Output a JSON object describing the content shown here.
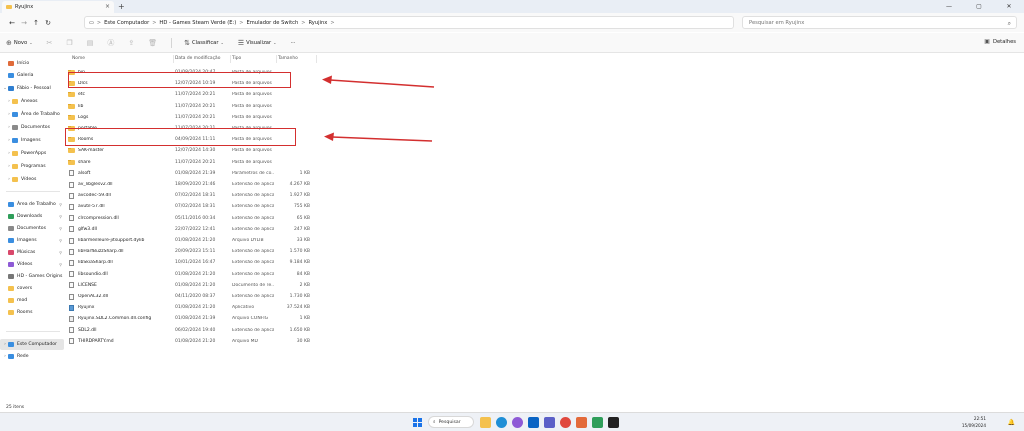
{
  "window": {
    "tab_title": "Ryujinx",
    "tab_close": "×",
    "tab_add": "+",
    "controls": {
      "minimize": "—",
      "maximize": "▢",
      "close": "✕"
    }
  },
  "address": {
    "crumbs": [
      "Este Computador",
      "HD - Games Steam Verde (E:)",
      "Emulador de Switch",
      "Ryujinx"
    ],
    "separator": ">",
    "search_placeholder": "Pesquisar em Ryujinx"
  },
  "toolbar": {
    "new_label": "Novo",
    "sort_label": "Classificar",
    "view_label": "Visualizar",
    "more_label": "···",
    "details_label": "Detalhes"
  },
  "sidebar": {
    "items": [
      {
        "label": "Início",
        "color": "#e06b3a"
      },
      {
        "label": "Galeria",
        "color": "#3a8ee0"
      },
      {
        "label": "Fábio - Pessoal",
        "color": "#2f7fd1"
      },
      {
        "label": "Anexos",
        "color": "#f4c14e"
      },
      {
        "label": "Área de Trabalho",
        "color": "#3a8ee0"
      },
      {
        "label": "Documentos",
        "color": "#8a8a8a"
      },
      {
        "label": "Imagens",
        "color": "#3a8ee0"
      },
      {
        "label": "PowerApps",
        "color": "#f4c14e"
      },
      {
        "label": "Programas",
        "color": "#f4c14e"
      },
      {
        "label": "Vídeos",
        "color": "#f4c14e"
      },
      {
        "label": "Área de Trabalho",
        "color": "#3a8ee0"
      },
      {
        "label": "Downloads",
        "color": "#2f9e5a"
      },
      {
        "label": "Documentos",
        "color": "#8a8a8a"
      },
      {
        "label": "Imagens",
        "color": "#3a8ee0"
      },
      {
        "label": "Músicas",
        "color": "#d9486b"
      },
      {
        "label": "Vídeos",
        "color": "#8e5ad6"
      },
      {
        "label": "HD - Games Origins",
        "color": "#777777"
      },
      {
        "label": "covers",
        "color": "#f4c14e"
      },
      {
        "label": "mod",
        "color": "#f4c14e"
      },
      {
        "label": "Rooms",
        "color": "#f4c14e"
      },
      {
        "label": "Este Computador",
        "color": "#3a8ee0"
      },
      {
        "label": "Rede",
        "color": "#3a8ee0"
      }
    ]
  },
  "columns": {
    "name": "Nome",
    "date": "Data de modificação",
    "type": "Tipo",
    "size": "Tamanho"
  },
  "files": [
    {
      "name": "bin",
      "date": "01/08/2024 20:47",
      "type": "Pasta de arquivos",
      "size": "",
      "kind": "folder"
    },
    {
      "name": "Dlcs",
      "date": "12/07/2024 10:19",
      "type": "Pasta de arquivos",
      "size": "",
      "kind": "folder"
    },
    {
      "name": "etc",
      "date": "11/07/2024 20:21",
      "type": "Pasta de arquivos",
      "size": "",
      "kind": "folder"
    },
    {
      "name": "lib",
      "date": "11/07/2024 20:21",
      "type": "Pasta de arquivos",
      "size": "",
      "kind": "folder"
    },
    {
      "name": "Logs",
      "date": "11/07/2024 20:21",
      "type": "Pasta de arquivos",
      "size": "",
      "kind": "folder"
    },
    {
      "name": "portable",
      "date": "11/07/2024 20:21",
      "type": "Pasta de arquivos",
      "size": "",
      "kind": "folder"
    },
    {
      "name": "Rooms",
      "date": "04/09/2024 11:11",
      "type": "Pasta de arquivos",
      "size": "",
      "kind": "folder"
    },
    {
      "name": "SAK-master",
      "date": "12/07/2024 14:30",
      "type": "Pasta de arquivos",
      "size": "",
      "kind": "folder"
    },
    {
      "name": "share",
      "date": "11/07/2024 20:21",
      "type": "Pasta de arquivos",
      "size": "",
      "kind": "folder"
    },
    {
      "name": "alsoft",
      "date": "01/08/2024 21:39",
      "type": "Parâmetros de co...",
      "size": "1 KB",
      "kind": "file"
    },
    {
      "name": "av_libglesv2.dll",
      "date": "18/09/2020 21:46",
      "type": "Extensão de aplica...",
      "size": "4.267 KB",
      "kind": "file"
    },
    {
      "name": "avcodec-59.dll",
      "date": "07/02/2024 18:31",
      "type": "Extensão de aplica...",
      "size": "1.927 KB",
      "kind": "file"
    },
    {
      "name": "avutil-57.dll",
      "date": "07/02/2024 18:31",
      "type": "Extensão de aplica...",
      "size": "755 KB",
      "kind": "file"
    },
    {
      "name": "clrcompression.dll",
      "date": "05/11/2016 00:34",
      "type": "Extensão de aplica...",
      "size": "65 KB",
      "kind": "file"
    },
    {
      "name": "glfw3.dll",
      "date": "22/07/2022 12:41",
      "type": "Extensão de aplica...",
      "size": "247 KB",
      "kind": "file"
    },
    {
      "name": "libarmeilleure-jitsupport.dylib",
      "date": "01/08/2024 21:20",
      "type": "Arquivo DYLIB",
      "size": "33 KB",
      "kind": "file"
    },
    {
      "name": "libHarfBuzzSharp.dll",
      "date": "20/09/2023 15:11",
      "type": "Extensão de aplica...",
      "size": "1.570 KB",
      "kind": "file"
    },
    {
      "name": "libSkiaSharp.dll",
      "date": "10/01/2024 16:47",
      "type": "Extensão de aplica...",
      "size": "9.184 KB",
      "kind": "file"
    },
    {
      "name": "libsoundio.dll",
      "date": "01/08/2024 21:20",
      "type": "Extensão de aplica...",
      "size": "84 KB",
      "kind": "file"
    },
    {
      "name": "LICENSE",
      "date": "01/08/2024 21:20",
      "type": "Documento de Te...",
      "size": "2 KB",
      "kind": "file"
    },
    {
      "name": "OpenAL32.dll",
      "date": "04/11/2020 08:37",
      "type": "Extensão de aplica...",
      "size": "1.730 KB",
      "kind": "file"
    },
    {
      "name": "Ryujinx",
      "date": "01/08/2024 21:20",
      "type": "Aplicativo",
      "size": "37.524 KB",
      "kind": "exe"
    },
    {
      "name": "Ryujinx.SDL2.Common.dll.config",
      "date": "01/08/2024 21:39",
      "type": "Arquivo CONFIG",
      "size": "1 KB",
      "kind": "gear"
    },
    {
      "name": "SDL2.dll",
      "date": "06/02/2024 19:40",
      "type": "Extensão de aplica...",
      "size": "1.650 KB",
      "kind": "file"
    },
    {
      "name": "THIRDPARTY.md",
      "date": "01/08/2024 21:20",
      "type": "Arquivo MD",
      "size": "30 KB",
      "kind": "file"
    }
  ],
  "status": {
    "item_count": "25 itens"
  },
  "taskbar": {
    "search_label": "Pesquisar",
    "time": "22:51",
    "date": "15/09/2024",
    "apps": [
      "windows-icon",
      "search-icon",
      "file-explorer-icon",
      "edge-icon",
      "copilot-icon",
      "outlook-icon",
      "teams-icon",
      "chrome-icon",
      "photos-icon",
      "xbox-icon",
      "nvidia-icon"
    ]
  },
  "accent": {
    "highlight": "#d32f2f",
    "folder": "#f4c14e"
  }
}
